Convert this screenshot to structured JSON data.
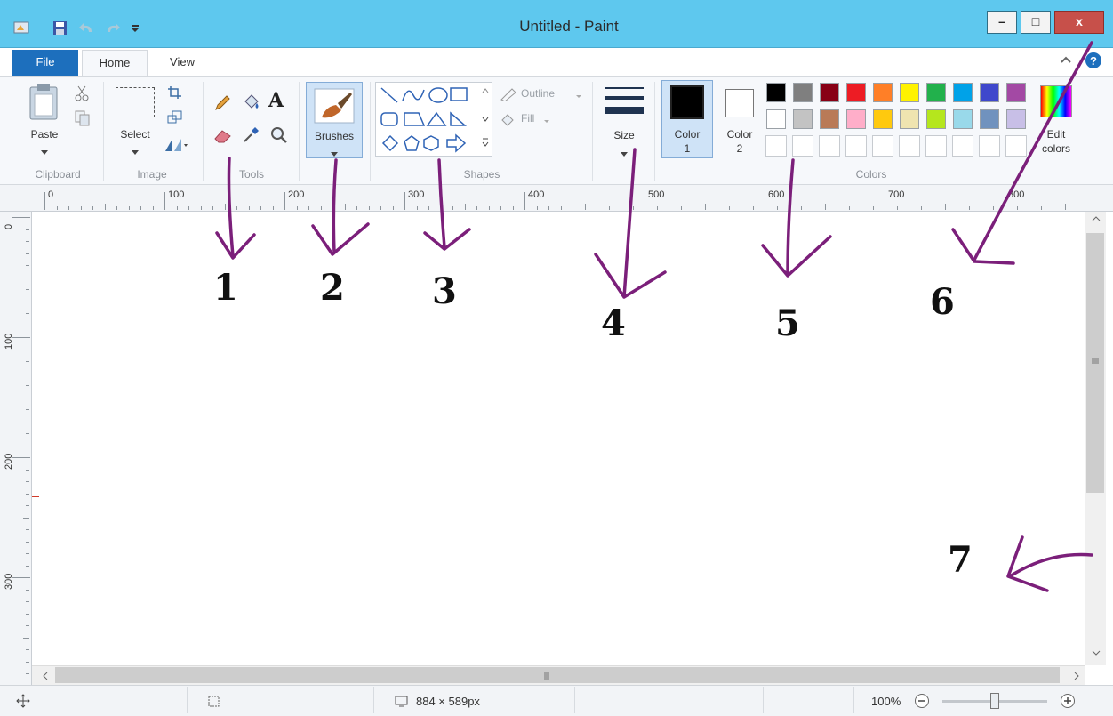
{
  "window": {
    "title": "Untitled - Paint",
    "minimize_label": "–",
    "maximize_label": "□",
    "close_label": "x"
  },
  "tabs": {
    "file": "File",
    "home": "Home",
    "view": "View"
  },
  "clipboard": {
    "paste": "Paste",
    "group_label": "Clipboard"
  },
  "image": {
    "select": "Select",
    "group_label": "Image"
  },
  "tools": {
    "group_label": "Tools",
    "text_tool_glyph": "A"
  },
  "brushes": {
    "label": "Brushes"
  },
  "shapes": {
    "outline": "Outline",
    "fill": "Fill",
    "group_label": "Shapes"
  },
  "size": {
    "label": "Size"
  },
  "colors": {
    "color1_label": "Color",
    "color1_num": "1",
    "color2_label": "Color",
    "color2_num": "2",
    "group_label": "Colors",
    "edit_line1": "Edit",
    "edit_line2": "colors",
    "color1_value": "#000000",
    "color2_value": "#ffffff",
    "palette_row1": [
      "#000000",
      "#7f7f7f",
      "#880015",
      "#ed1c24",
      "#ff7f27",
      "#fff200",
      "#22b14c",
      "#00a2e8",
      "#3f48cc",
      "#a349a4"
    ],
    "palette_row2": [
      "#ffffff",
      "#c3c3c3",
      "#b97a57",
      "#ffaec9",
      "#ffc90e",
      "#efe4b0",
      "#b5e61d",
      "#99d9ea",
      "#7092be",
      "#c8bfe7"
    ]
  },
  "ruler": {
    "h": [
      "0",
      "100",
      "200",
      "300",
      "400",
      "500",
      "600",
      "700",
      "800"
    ],
    "v": [
      "0",
      "100",
      "200",
      "300"
    ]
  },
  "annotations": [
    "1",
    "2",
    "3",
    "4",
    "5",
    "6",
    "7"
  ],
  "status": {
    "dimensions": "884 × 589px",
    "zoom": "100%"
  },
  "accent_color": "#7b1f7a"
}
